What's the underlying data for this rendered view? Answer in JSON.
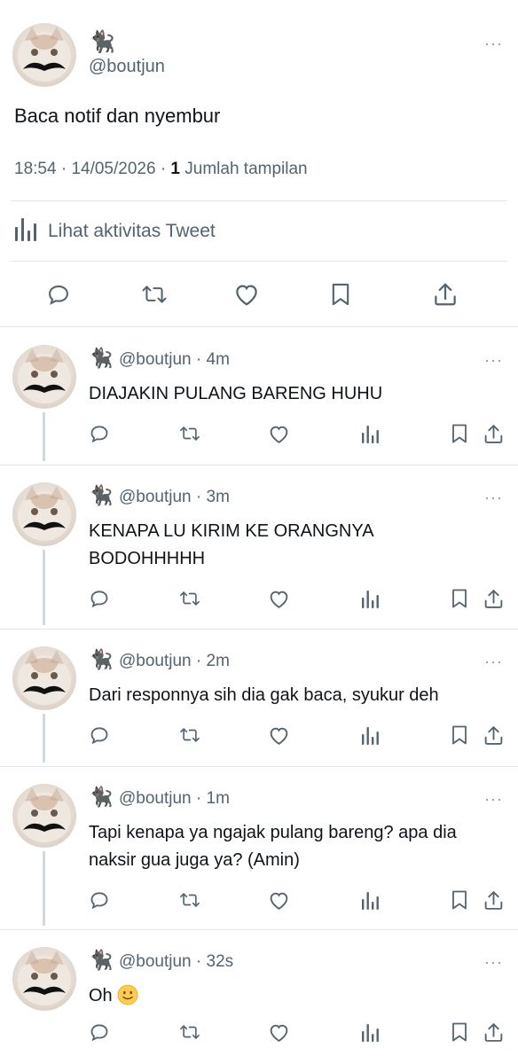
{
  "main_tweet": {
    "emoji": "🐈‍⬛",
    "handle": "@boutjun",
    "text": "Baca notif dan nyembur",
    "time": "18:54",
    "date": "14/05/2026",
    "views_count": "1",
    "views_label": "Jumlah tampilan",
    "activity_label": "Lihat aktivitas Tweet",
    "actions": [
      "reply-icon",
      "retweet-icon",
      "like-icon",
      "bookmark-icon",
      "share-icon"
    ]
  },
  "replies": [
    {
      "handle": "@boutjun",
      "time": "4m",
      "lines": [
        "DIAJAKIN PULANG BARENG HUHU"
      ]
    },
    {
      "handle": "@boutjun",
      "time": "3m",
      "lines": [
        "KENAPA LU KIRIM KE ORANGNYA",
        "BODOHHHHH"
      ]
    },
    {
      "handle": "@boutjun",
      "time": "2m",
      "lines": [
        "Dari responnya sih dia gak baca, syukur deh"
      ]
    },
    {
      "handle": "@boutjun",
      "time": "1m",
      "lines": [
        "Tapi kenapa ya ngajak pulang bareng? apa dia",
        "naksir gua juga ya? (Amin)"
      ]
    },
    {
      "handle": "@boutjun",
      "time": "32s",
      "text_prefix": "Oh",
      "text_emoji": "slightly-smiling-face"
    }
  ],
  "icons": {
    "more": "more-dots-icon",
    "reply_actions": [
      "reply-icon",
      "retweet-icon",
      "like-icon",
      "views-icon",
      "bookmark-icon",
      "share-icon"
    ]
  },
  "colors": {
    "text": "#0f1419",
    "secondary": "#536471",
    "divider": "#e1e6ea",
    "thread": "#cfd9de"
  }
}
